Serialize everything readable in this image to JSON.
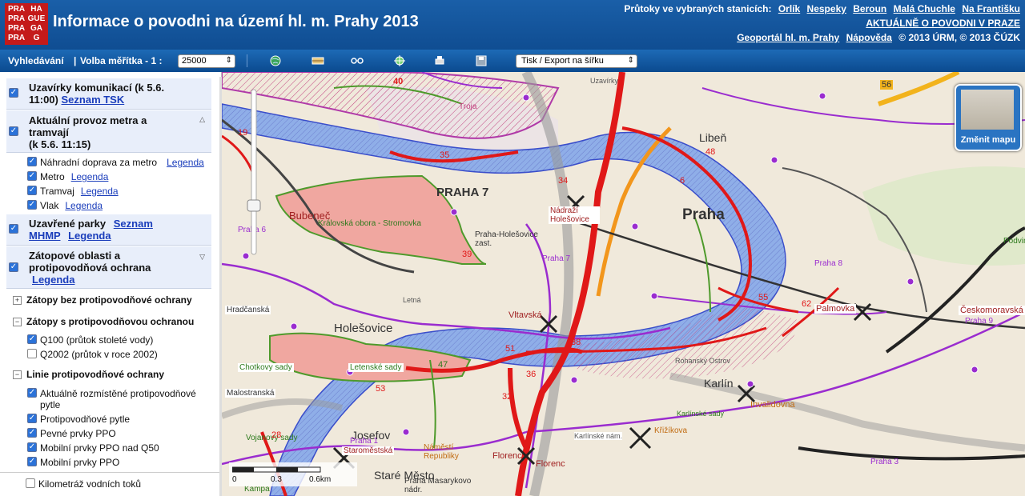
{
  "header": {
    "logo": [
      "PRA",
      "HA",
      "PRA",
      "GUE",
      "PRA",
      "GA",
      "PRA",
      "G"
    ],
    "title": "Informace o povodni na území hl. m. Prahy 2013",
    "flows_label": "Průtoky ve vybraných stanicích:",
    "stations": [
      "Orlík",
      "Nespeky",
      "Beroun",
      "Malá Chuchle",
      "Na Františku"
    ],
    "current_link": "AKTUÁLNĚ O POVODNI V PRAZE",
    "geoportal_link": "Geoportál hl. m. Prahy",
    "help_link": "Nápověda",
    "copyright": "© 2013 ÚRM, © 2013 ČÚZK"
  },
  "toolbar": {
    "search": "Vyhledávání",
    "scale_label": "Volba měřítka - 1 :",
    "scale_value": "25000",
    "export_value": "Tisk / Export na šířku",
    "icons": [
      "globe-icon",
      "layers-icon",
      "measure-icon",
      "locate-icon",
      "print-icon",
      "save-icon"
    ]
  },
  "sidebar": {
    "road_closures": {
      "label": "Uzavírky komunikací (k 5.6. 11:00)",
      "link": "Seznam TSK"
    },
    "transit": {
      "label": "Aktuální provoz metra a tramvají",
      "date": "(k 5.6. 11:15)"
    },
    "transit_items": [
      {
        "label": "Náhradní doprava za metro",
        "link": "Legenda"
      },
      {
        "label": "Metro",
        "link": "Legenda"
      },
      {
        "label": "Tramvaj",
        "link": "Legenda"
      },
      {
        "label": "Vlak",
        "link": "Legenda"
      }
    ],
    "parks": {
      "label": "Uzavřené parky",
      "link1": "Seznam",
      "link1b": "MHMP",
      "link2": "Legenda"
    },
    "flood": {
      "label": "Zátopové oblasti a protipovodňová ochrana",
      "link": "Legenda"
    },
    "sec_unprotected": "Zátopy bez protipovodňové ochrany",
    "sec_protected": "Zátopy s protipovodňovou ochranou",
    "protected_items": [
      {
        "label": "Q100 (průtok stoleté vody)",
        "checked": true
      },
      {
        "label": "Q2002 (průtok v roce 2002)",
        "checked": false
      }
    ],
    "sec_lines": "Linie protipovodňové ochrany",
    "line_items": [
      "Aktuálně rozmístěné protipovodňové pytle",
      "Protipovodňové pytle",
      "Pevné prvky PPO",
      "Mobilní prvky PPO nad Q50",
      "Mobilní prvky PPO"
    ],
    "km": "Kilometráž vodních toků"
  },
  "map": {
    "change_map": "Změnit mapu",
    "scale_ticks": [
      "0",
      "0.3",
      "0.6km"
    ],
    "labels": {
      "praha7": "PRAHA 7",
      "praha": "Praha",
      "liben": "Libeň",
      "bubenec": "Bubeneč",
      "stromovka": "Královská obora - Stromovka",
      "holesovice": "Holešovice",
      "karlin": "Karlín",
      "josefov": "Josefov",
      "stare_mesto": "Staré Město",
      "nadrazi": "Nádraží Holešovice",
      "praha_hol": "Praha-Holešovice zast.",
      "vltavska": "Vltavská",
      "palmovka": "Palmovka",
      "invalidovna": "Invalidovna",
      "krizikova": "Křižíkova",
      "florenc1": "Florenc",
      "florenc2": "Florenc",
      "staromestska": "Staroměstská",
      "namesti": "Náměstí Republiky",
      "masarykovo": "Praha Masarykovo nádr.",
      "hradcanska": "Hradčanská",
      "malostranska": "Malostranská",
      "letenske": "Letenské sady",
      "chotkovy": "Chotkovy sady",
      "vojanovy": "Vojanovy sady",
      "kampa": "Kampa",
      "ceskomor": "Českomoravská",
      "podvinni": "Podvinní",
      "troja": "Troja",
      "praha6": "Praha 6",
      "praha7b": "Praha 7",
      "praha8": "Praha 8",
      "praha9": "Praha 9",
      "praha3": "Praha 3",
      "praha1": "Praha 1",
      "letna": "Letná",
      "karlinske": "Karlínské nám.",
      "karlinske_sady": "Karlínské sady",
      "rohansky": "Rohanský Ostrov",
      "uzavirky": "Uzavírky"
    },
    "numbers": [
      "40",
      "35",
      "34",
      "48",
      "6",
      "39",
      "55",
      "62",
      "38",
      "51",
      "36",
      "53",
      "32",
      "47",
      "19",
      "28",
      "56"
    ]
  }
}
